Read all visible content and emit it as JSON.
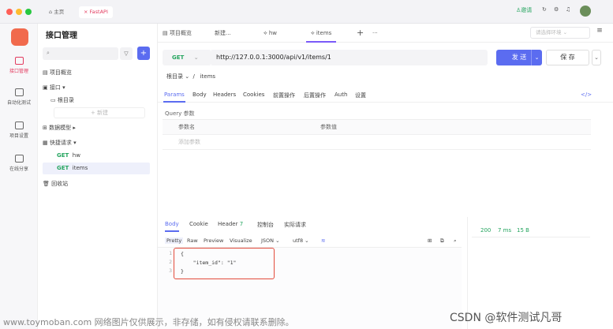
{
  "window": {
    "tabs": [
      {
        "label": "主页"
      },
      {
        "label": "FastAPI"
      }
    ],
    "right": {
      "invite": "邀请"
    }
  },
  "sidebar": {
    "items": [
      {
        "label": "接口管理",
        "color": "#e33b5f"
      },
      {
        "label": "自动化测试"
      },
      {
        "label": "项目设置"
      },
      {
        "label": "在线分享"
      }
    ],
    "app_icon_color": "#f16a4d"
  },
  "tree": {
    "title": "接口管理",
    "search_placeholder": "",
    "items": [
      {
        "label": "项目概览"
      },
      {
        "label": "接口 ▾"
      },
      {
        "label": "根目录"
      },
      {
        "label": "+ 新建"
      },
      {
        "label": "数据模型 ▸"
      },
      {
        "label": "快捷请求 ▾"
      },
      {
        "method": "GET",
        "label": "hw"
      },
      {
        "method": "GET",
        "label": "items"
      },
      {
        "label": "回收站"
      }
    ]
  },
  "tabs": {
    "items": [
      {
        "label": "项目概览"
      },
      {
        "label": "新建..."
      },
      {
        "label": "hw"
      },
      {
        "label": "items"
      }
    ],
    "env_placeholder": "请选择环境"
  },
  "request": {
    "method": "GET",
    "url": "http://127.0.0.1:3000/api/v1/items/1",
    "send": "发 送",
    "save": "保 存",
    "breadcrumb_root": "根目录",
    "breadcrumb_sep": "/",
    "breadcrumb_leaf": "items"
  },
  "request_tabs": [
    "Params",
    "Body",
    "Headers",
    "Cookies",
    "前置操作",
    "后置操作",
    "Auth",
    "设置"
  ],
  "params": {
    "section": "Query 参数",
    "col_name": "参数名",
    "col_value": "参数值",
    "add_placeholder": "添加参数"
  },
  "response": {
    "tabs": [
      "Body",
      "Cookie",
      "Header",
      "控制台",
      "实际请求"
    ],
    "header_count": "7",
    "view": [
      "Pretty",
      "Raw",
      "Preview",
      "Visualize",
      "JSON",
      "utf8"
    ],
    "lines": [
      "1",
      "2",
      "3"
    ],
    "code": "{\n    \"item_id\": \"1\"\n}",
    "status": "200",
    "time": "7 ms",
    "size": "15 B"
  },
  "watermark": {
    "left": "www.toymoban.com 网络图片仅供展示，非存储，如有侵权请联系删除。",
    "right": "CSDN @软件测试凡哥"
  }
}
